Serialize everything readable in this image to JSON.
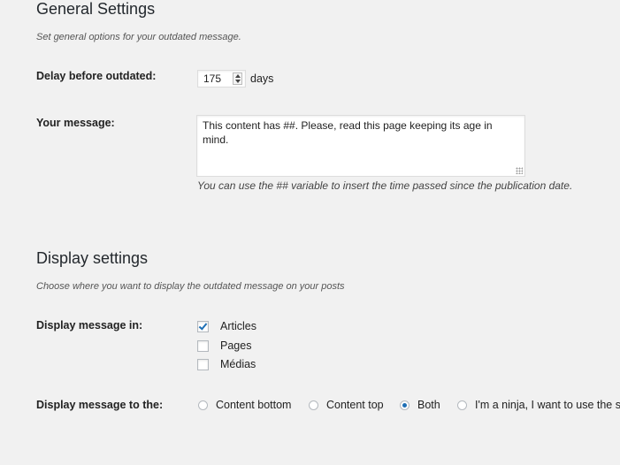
{
  "general": {
    "title": "General Settings",
    "description": "Set general options for your outdated message.",
    "delay_label": "Delay before outdated:",
    "delay_value": "175",
    "delay_unit": "days",
    "message_label": "Your message:",
    "message_value": "This content has ##. Please, read this page  keeping its age in mind.",
    "message_hint": "You can use the ## variable to insert the time passed since the publication date."
  },
  "display": {
    "title": "Display settings",
    "description": "Choose where you want to display the outdated message on your posts",
    "location_label": "Display message in:",
    "locations": [
      {
        "label": "Articles",
        "checked": true
      },
      {
        "label": "Pages",
        "checked": false
      },
      {
        "label": "Médias",
        "checked": false
      }
    ],
    "position_label": "Display message to the:",
    "positions": [
      {
        "label": "Content bottom",
        "checked": false
      },
      {
        "label": "Content top",
        "checked": false
      },
      {
        "label": "Both",
        "checked": true
      },
      {
        "label": "I'm a ninja, I want to use the sh",
        "checked": false
      }
    ]
  },
  "colors": {
    "accent": "#1e6fb5",
    "background": "#f1f1f1"
  }
}
